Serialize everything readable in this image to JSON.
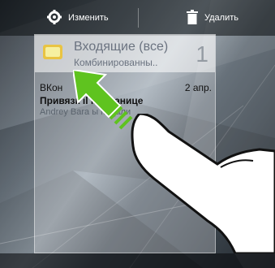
{
  "topbar": {
    "edit_label": "Изменить",
    "delete_label": "Удалить",
    "edit_icon": "gear-icon",
    "delete_icon": "trash-icon"
  },
  "widget": {
    "title": "Входящие (все)",
    "subtitle": "Комбинированны..",
    "unread_count": "1",
    "message": {
      "sender": "ВКон",
      "date": "2 апр.",
      "subject": "Привязк        il к странице",
      "preview": "Andrey Bara         ы подали"
    }
  },
  "colors": {
    "arrow": "#5fc31f",
    "icon_mail": "#e9c443"
  }
}
